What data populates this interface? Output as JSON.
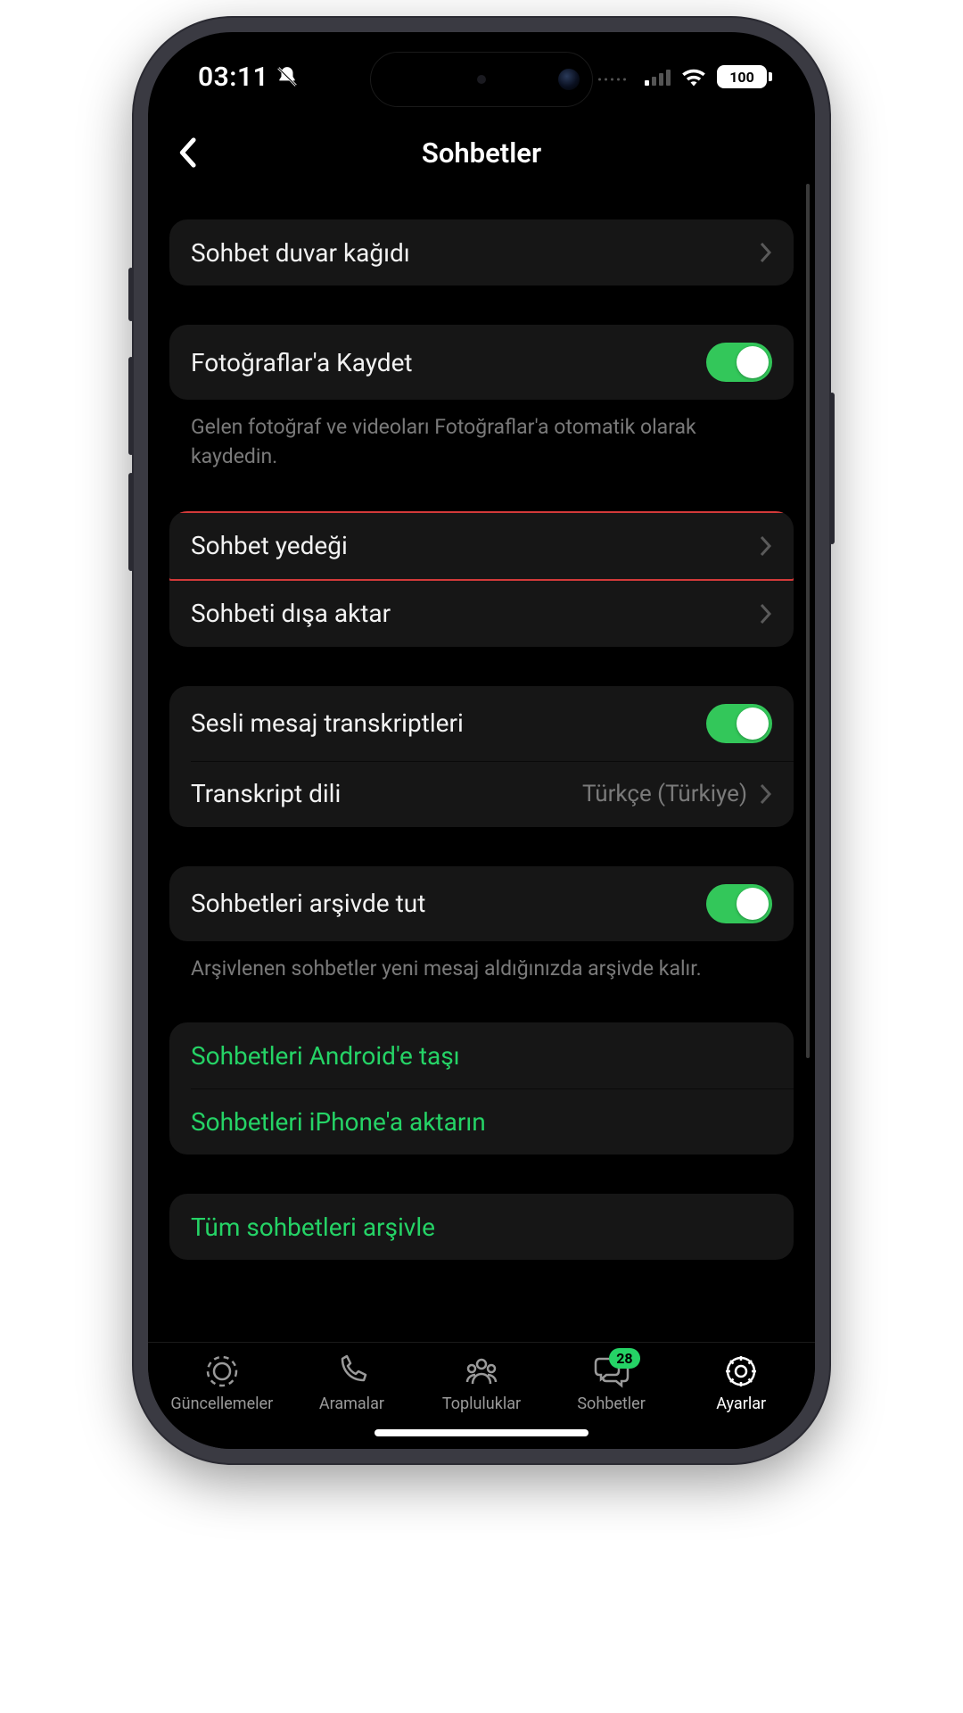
{
  "status": {
    "time": "03:11",
    "battery": "100"
  },
  "header": {
    "title": "Sohbetler"
  },
  "rows": {
    "wallpaper": "Sohbet duvar kağıdı",
    "save_photos": "Fotoğraflar'a Kaydet",
    "save_photos_desc": "Gelen fotoğraf ve videoları Fotoğraflar'a otomatik olarak kaydedin.",
    "chat_backup": "Sohbet yedeği",
    "export_chat": "Sohbeti dışa aktar",
    "voice_transcripts": "Sesli mesaj transkriptleri",
    "transcript_lang_label": "Transkript dili",
    "transcript_lang_value": "Türkçe (Türkiye)",
    "keep_archived": "Sohbetleri arşivde tut",
    "keep_archived_desc": "Arşivlenen sohbetler yeni mesaj aldığınızda arşivde kalır.",
    "move_android": "Sohbetleri Android'e taşı",
    "transfer_iphone": "Sohbetleri iPhone'a aktarın",
    "archive_all": "Tüm sohbetleri arşivle"
  },
  "tabs": {
    "updates": "Güncellemeler",
    "calls": "Aramalar",
    "communities": "Topluluklar",
    "chats": "Sohbetler",
    "settings": "Ayarlar",
    "chats_badge": "28"
  }
}
